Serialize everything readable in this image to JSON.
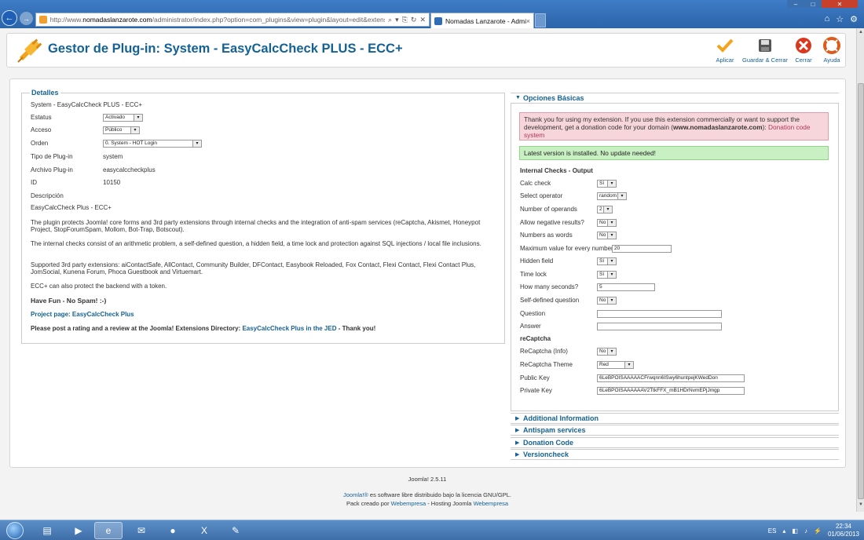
{
  "browser": {
    "url_prefix": "http://www.",
    "url_domain": "nomadaslanzarote.com",
    "url_rest": "/administrator/index.php?option=com_plugins&view=plugin&layout=edit&extension_id=",
    "tab_title": "Nomadas Lanzarote - Admi...",
    "tab_close": "×"
  },
  "header": {
    "title": "Gestor de Plug-in: System - EasyCalcCheck PLUS - ECC+",
    "toolbar": [
      {
        "label": "Aplicar",
        "icon": "check-icon"
      },
      {
        "label": "Guardar & Cerrar",
        "icon": "save-icon"
      },
      {
        "label": "Cerrar",
        "icon": "close-icon"
      },
      {
        "label": "Ayuda",
        "icon": "help-icon"
      }
    ]
  },
  "details": {
    "legend": "Detalles",
    "name": "System - EasyCalcCheck PLUS - ECC+",
    "status_label": "Estatus",
    "status_value": "Activado",
    "access_label": "Acceso",
    "access_value": "Público",
    "order_label": "Orden",
    "order_value": "0. System - HOT Login",
    "type_label": "Tipo de Plug-in",
    "type_value": "system",
    "file_label": "Archivo Plug-in",
    "file_value": "easycalccheckplus",
    "id_label": "ID",
    "id_value": "10150",
    "desc_label": "Descripción",
    "desc_title": "EasyCalcCheck Plus - ECC+",
    "p1": "The plugin protects Joomla! core forms and 3rd party extensions through internal checks and the integration of anti-spam services (reCaptcha, Akismet, Honeypot Project, StopForumSpam, Mollom, Bot-Trap, Botscout).",
    "p2": "The internal checks consist of an arithmetic problem, a self-defined question, a hidden field, a time lock and protection against SQL injections / local file inclusions.",
    "p3": "Supported 3rd party extensions: aiContactSafe, AllContact, Community Builder, DFContact, Easybook Reloaded, Fox Contact, Flexi Contact, Flexi Contact Plus, JomSocial, Kunena Forum, Phoca Guestbook and Virtuemart.",
    "p4": "ECC+ can also protect the backend with a token.",
    "fun": "Have Fun - No Spam! :-)",
    "project_label": "Project page:",
    "project_link": "EasyCalcCheck Plus",
    "rating_pre": "Please post a rating and a review at the Joomla! Extensions Directory:",
    "rating_link": "EasyCalcCheck Plus in the JED",
    "rating_post": " - Thank you!"
  },
  "options": {
    "title": "Opciones Básicas",
    "donation_msg_pre": "Thank you for using my extension. If you use this extension commercially or want to support the development, get a donation code for your domain (",
    "donation_msg_domain": "www.nomadaslanzarote.com",
    "donation_msg_post": "): ",
    "donation_link": "Donation code system",
    "update_msg": "Latest version is installed. No update needed!",
    "internal_title": "Internal Checks - Output",
    "calc_check": {
      "label": "Calc check",
      "value": "Sí"
    },
    "operator": {
      "label": "Select operator",
      "value": "random"
    },
    "operands": {
      "label": "Number of operands",
      "value": "2"
    },
    "negative": {
      "label": "Allow negative results?",
      "value": "No"
    },
    "words": {
      "label": "Numbers as words",
      "value": "No"
    },
    "maxval": {
      "label": "Maximum value for every number",
      "value": "20"
    },
    "hidden": {
      "label": "Hidden field",
      "value": "Sí"
    },
    "timelock": {
      "label": "Time lock",
      "value": "Sí"
    },
    "seconds": {
      "label": "How many seconds?",
      "value": "5"
    },
    "selfq": {
      "label": "Self-defined question",
      "value": "No"
    },
    "question": {
      "label": "Question",
      "value": ""
    },
    "answer": {
      "label": "Answer",
      "value": ""
    },
    "recaptcha_title": "reCaptcha",
    "recaptcha_info": {
      "label": "ReCaptcha (Info)",
      "value": "No"
    },
    "recaptcha_theme": {
      "label": "ReCaptcha Theme",
      "value": "Red"
    },
    "public_key": {
      "label": "Public Key",
      "value": "6LeBPOISAAAAACFrwqnn6ISwy6huntpejKWedDon"
    },
    "private_key": {
      "label": "Private Key",
      "value": "6LeBPOISAAAAAAV2TtkFFX_mB1HDrNvmEPjJmgp"
    }
  },
  "collapsed_panes": [
    "Additional Information",
    "Antispam services",
    "Donation Code",
    "Versioncheck"
  ],
  "footer": {
    "version": "Joomla! 2.5.11",
    "license_link": "Joomla!®",
    "license_text": " es software libre distribuido bajo la licencia GNU/GPL.",
    "credits_pre": "Pack creado por ",
    "credits_link1": "Webempresa",
    "credits_mid": " - Hosting Joomla ",
    "credits_link2": "Webempresa"
  },
  "taskbar": {
    "lang": "ES",
    "time": "22:34",
    "date": "01/06/2013"
  },
  "colors": {
    "title_blue": "#146295",
    "apply_orange": "#f7a21b",
    "close_red": "#d9371e"
  }
}
